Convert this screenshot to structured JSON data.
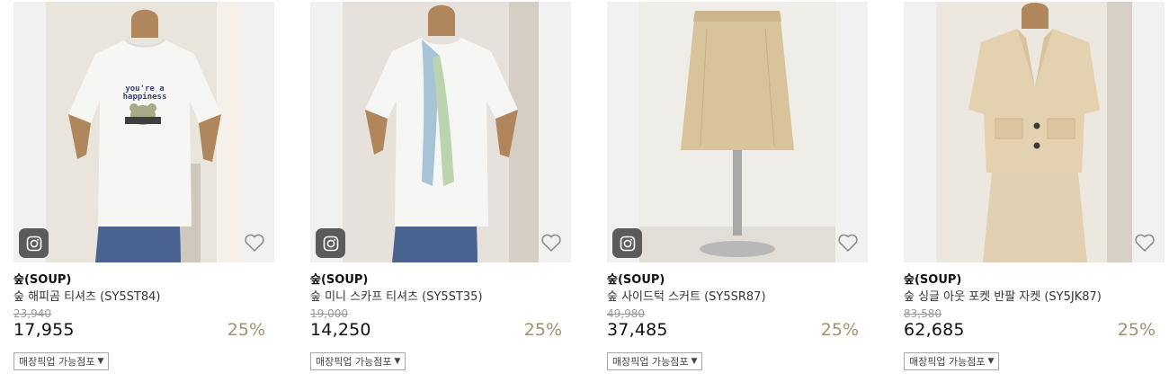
{
  "products": [
    {
      "brand": "숲(SOUP)",
      "name": "숲 해피곰 티셔츠 (SY5ST84)",
      "original_price": "23,940",
      "price": "17,955",
      "discount": "25%",
      "pickup_label": "매장픽업 가능점포",
      "has_instagram": true,
      "print_text": [
        "you're a",
        "happiness"
      ]
    },
    {
      "brand": "숲(SOUP)",
      "name": "숲 미니 스카프 티셔츠 (SY5ST35)",
      "original_price": "19,000",
      "price": "14,250",
      "discount": "25%",
      "pickup_label": "매장픽업 가능점포",
      "has_instagram": true
    },
    {
      "brand": "숲(SOUP)",
      "name": "숲 사이드턱 스커트 (SY5SR87)",
      "original_price": "49,980",
      "price": "37,485",
      "discount": "25%",
      "pickup_label": "매장픽업 가능점포",
      "has_instagram": true
    },
    {
      "brand": "숲(SOUP)",
      "name": "숲 싱글 아웃 포켓 반팔 자켓 (SY5JK87)",
      "original_price": "83,580",
      "price": "62,685",
      "discount": "25%",
      "pickup_label": "매장픽업 가능점포",
      "has_instagram": false
    }
  ],
  "icons": {
    "instagram": "instagram-icon",
    "wishlist": "heart-outline-icon",
    "dropdown": "caret-down-icon"
  },
  "colors": {
    "discount": "#a09271",
    "original_price": "#999999",
    "instagram_badge": "#5b5b5b"
  }
}
